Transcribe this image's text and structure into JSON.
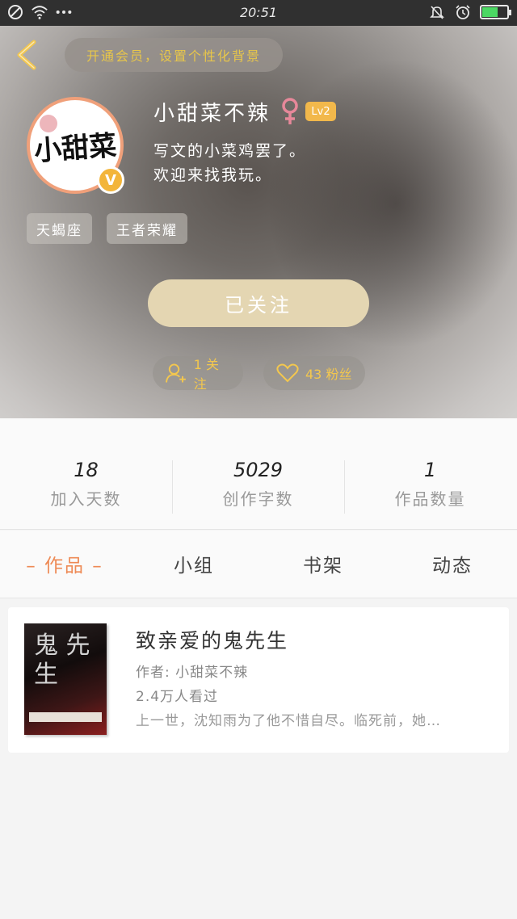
{
  "status_bar": {
    "time": "20:51",
    "battery_level": 0.6,
    "icons": [
      "blocked-icon",
      "wifi-icon",
      "more-dots-icon",
      "mute-bell-icon",
      "alarm-icon",
      "battery-charging-icon"
    ]
  },
  "header": {
    "vip_prompt": "开通会员，设置个性化背景",
    "avatar_text": "小甜菜",
    "verified_badge": "V",
    "username": "小甜菜不辣",
    "gender": "female",
    "level": "Lv2",
    "bio_line1": "写文的小菜鸡罢了。",
    "bio_line2": "欢迎来找我玩。",
    "tags": [
      "天蝎座",
      "王者荣耀"
    ],
    "follow_button": "已关注",
    "following_count": "1 关注",
    "fans_count": "43 粉丝"
  },
  "stats": [
    {
      "value": "18",
      "label": "加入天数"
    },
    {
      "value": "5029",
      "label": "创作字数"
    },
    {
      "value": "1",
      "label": "作品数量"
    }
  ],
  "tabs": [
    {
      "label": "作品",
      "active": true
    },
    {
      "label": "小组",
      "active": false
    },
    {
      "label": "书架",
      "active": false
    },
    {
      "label": "动态",
      "active": false
    }
  ],
  "works": [
    {
      "cover_text": "鬼 先 生",
      "title": "致亲爱的鬼先生",
      "author": "作者: 小甜菜不辣",
      "reads": "2.4万人看过",
      "description": "上一世，沈知雨为了他不惜自尽。临死前，她…"
    }
  ],
  "colors": {
    "accent": "#ee8a55",
    "gold": "#f3c74e",
    "follow_button": "#e4d6b2",
    "level_badge": "#f2b84b"
  }
}
